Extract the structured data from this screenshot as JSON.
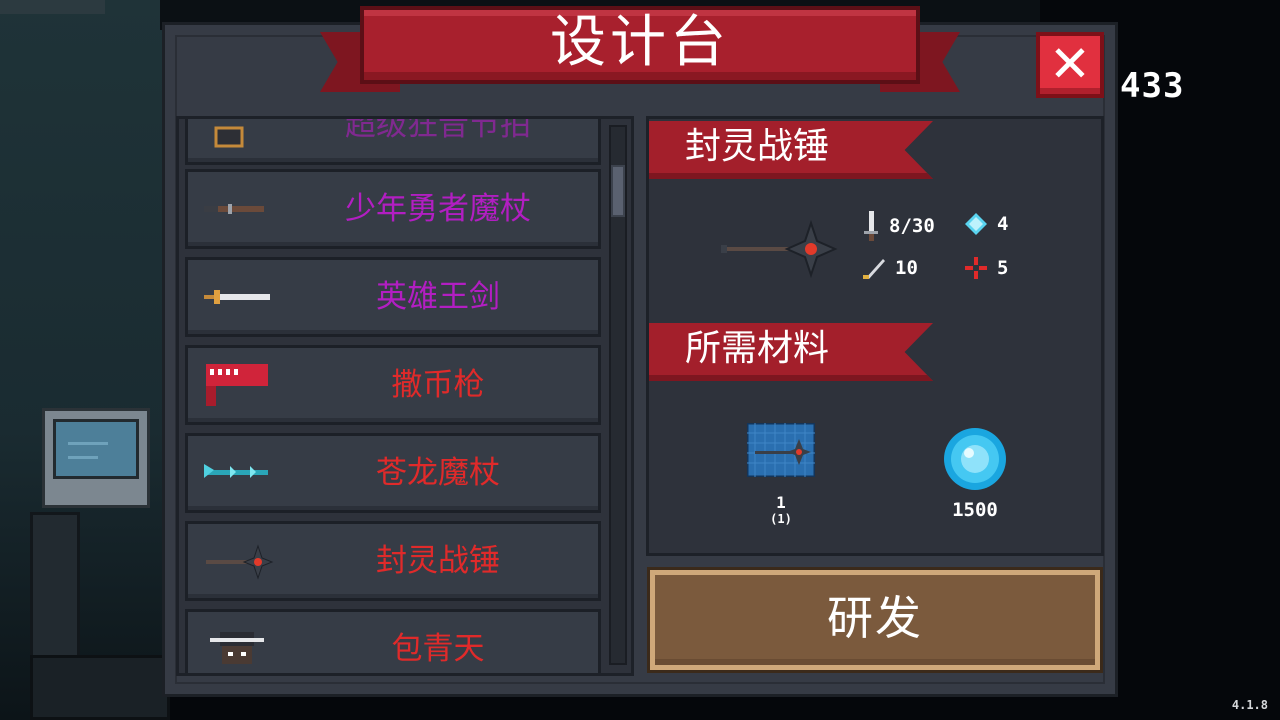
{
  "header": {
    "title": "设计台",
    "close_label": "✕"
  },
  "currency": {
    "gems": "433",
    "icon": "gem-icon"
  },
  "blueprint_list": {
    "items": [
      {
        "name": "超级狂音节拍",
        "color": "#b21ec2",
        "icon": "boombox-icon"
      },
      {
        "name": "少年勇者魔杖",
        "color": "#b21ec2",
        "icon": "staff-icon"
      },
      {
        "name": "英雄王剑",
        "color": "#b21ec2",
        "icon": "sword-icon"
      },
      {
        "name": "撒币枪",
        "color": "#e02a2a",
        "icon": "coin-gun-icon"
      },
      {
        "name": "苍龙魔杖",
        "color": "#e02a2a",
        "icon": "dragon-staff-icon"
      },
      {
        "name": "封灵战锤",
        "color": "#e02a2a",
        "icon": "war-hammer-icon"
      },
      {
        "name": "包青天",
        "color": "#e02a2a",
        "icon": "character-bao-icon"
      }
    ]
  },
  "detail": {
    "weapon_name": "封灵战锤",
    "weapon_icon": "war-hammer-icon",
    "stats": {
      "damage": "8/30",
      "energy": "4",
      "crit": "10",
      "accuracy": "5"
    },
    "materials_title": "所需材料",
    "materials": [
      {
        "icon": "blueprint-icon",
        "count": "1",
        "owned": "(1)"
      },
      {
        "icon": "gem-icon",
        "count": "1500"
      }
    ]
  },
  "research_button": {
    "label": "研发"
  },
  "version": "4.1.8",
  "colors": {
    "panel": "#363b45",
    "banner_red": "#a8202d",
    "button_brown": "#7b5a3d",
    "legendary_red": "#e02a2a",
    "epic_purple": "#b21ec2"
  }
}
